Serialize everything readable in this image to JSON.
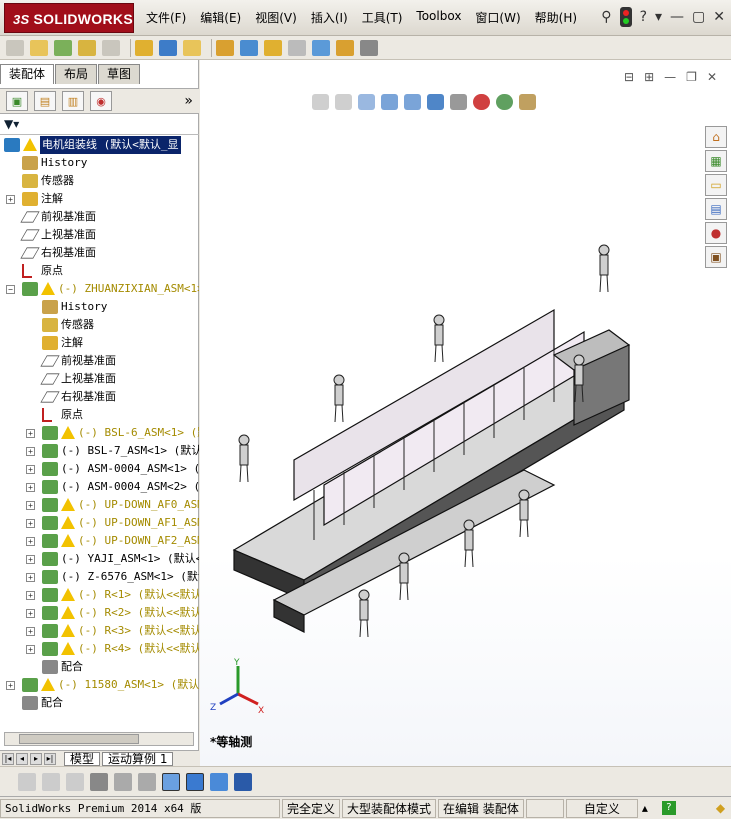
{
  "app": {
    "logo_text": "SOLIDWORKS",
    "logo_prefix": "3S"
  },
  "menus": [
    "文件(F)",
    "编辑(E)",
    "视图(V)",
    "插入(I)",
    "工具(T)",
    "Toolbox",
    "窗口(W)",
    "帮助(H)"
  ],
  "left_tabs": [
    "装配体",
    "布局",
    "草图"
  ],
  "active_tab": "装配体",
  "tree": {
    "root": "电机组装线 (默认<默认_显",
    "items": [
      {
        "label": "History",
        "indent": 1,
        "icon": "history-icon",
        "expander": ""
      },
      {
        "label": "传感器",
        "indent": 1,
        "icon": "sensor-icon",
        "expander": ""
      },
      {
        "label": "注解",
        "indent": 1,
        "icon": "annotation-icon",
        "expander": "+"
      },
      {
        "label": "前视基准面",
        "indent": 1,
        "icon": "plane-icon",
        "expander": ""
      },
      {
        "label": "上视基准面",
        "indent": 1,
        "icon": "plane-icon",
        "expander": ""
      },
      {
        "label": "右视基准面",
        "indent": 1,
        "icon": "plane-icon",
        "expander": ""
      },
      {
        "label": "原点",
        "indent": 1,
        "icon": "origin-icon",
        "expander": ""
      },
      {
        "label": "(-) ZHUANZIXIAN_ASM<1> (",
        "indent": 1,
        "icon": "assembly-icon",
        "expander": "−",
        "warn": true,
        "suppr": true
      },
      {
        "label": "History",
        "indent": 2,
        "icon": "history-icon",
        "expander": ""
      },
      {
        "label": "传感器",
        "indent": 2,
        "icon": "sensor-icon",
        "expander": ""
      },
      {
        "label": "注解",
        "indent": 2,
        "icon": "annotation-icon",
        "expander": ""
      },
      {
        "label": "前视基准面",
        "indent": 2,
        "icon": "plane-icon",
        "expander": ""
      },
      {
        "label": "上视基准面",
        "indent": 2,
        "icon": "plane-icon",
        "expander": ""
      },
      {
        "label": "右视基准面",
        "indent": 2,
        "icon": "plane-icon",
        "expander": ""
      },
      {
        "label": "原点",
        "indent": 2,
        "icon": "origin-icon",
        "expander": ""
      },
      {
        "label": "(-) BSL-6_ASM<1> (默",
        "indent": 2,
        "icon": "assembly-icon",
        "expander": "+",
        "warn": true,
        "suppr": true
      },
      {
        "label": "(-) BSL-7_ASM<1> (默认",
        "indent": 2,
        "icon": "assembly-icon",
        "expander": "+"
      },
      {
        "label": "(-) ASM-0004_ASM<1> (默",
        "indent": 2,
        "icon": "assembly-icon",
        "expander": "+"
      },
      {
        "label": "(-) ASM-0004_ASM<2> (默",
        "indent": 2,
        "icon": "assembly-icon",
        "expander": "+"
      },
      {
        "label": "(-) UP-DOWN_AF0_ASM<",
        "indent": 2,
        "icon": "assembly-icon",
        "expander": "+",
        "warn": true,
        "suppr": true
      },
      {
        "label": "(-) UP-DOWN_AF1_ASM<",
        "indent": 2,
        "icon": "assembly-icon",
        "expander": "+",
        "warn": true,
        "suppr": true
      },
      {
        "label": "(-) UP-DOWN_AF2_ASM<",
        "indent": 2,
        "icon": "assembly-icon",
        "expander": "+",
        "warn": true,
        "suppr": true
      },
      {
        "label": "(-) YAJI_ASM<1> (默认<",
        "indent": 2,
        "icon": "assembly-icon",
        "expander": "+"
      },
      {
        "label": "(-) Z-6576_ASM<1> (默认",
        "indent": 2,
        "icon": "assembly-icon",
        "expander": "+"
      },
      {
        "label": "(-) R<1> (默认<<默认",
        "indent": 2,
        "icon": "assembly-icon",
        "expander": "+",
        "warn": true,
        "suppr": true
      },
      {
        "label": "(-) R<2> (默认<<默认",
        "indent": 2,
        "icon": "assembly-icon",
        "expander": "+",
        "warn": true,
        "suppr": true
      },
      {
        "label": "(-) R<3> (默认<<默认",
        "indent": 2,
        "icon": "assembly-icon",
        "expander": "+",
        "warn": true,
        "suppr": true
      },
      {
        "label": "(-) R<4> (默认<<默认",
        "indent": 2,
        "icon": "assembly-icon",
        "expander": "+",
        "warn": true,
        "suppr": true
      },
      {
        "label": "配合",
        "indent": 2,
        "icon": "mates-icon",
        "expander": ""
      },
      {
        "label": "(-) 11580_ASM<1> (默认<",
        "indent": 1,
        "icon": "assembly-icon",
        "expander": "+",
        "warn": true,
        "suppr": true
      },
      {
        "label": "配合",
        "indent": 1,
        "icon": "mates-icon",
        "expander": ""
      }
    ]
  },
  "bottom_tabs": [
    "模型",
    "运动算例 1"
  ],
  "view_name": "*等轴测",
  "triad": {
    "x": "X",
    "y": "Y",
    "z": "Z"
  },
  "status": {
    "app": "SolidWorks Premium 2014 x64 版",
    "defined": "完全定义",
    "mode": "大型装配体模式",
    "editing": "在编辑 装配体",
    "units": "自定义"
  },
  "colors": {
    "brand": "#a10e1a",
    "selection": "#0a246a",
    "warning": "#f2c200",
    "suppressed": "#a48b00"
  }
}
